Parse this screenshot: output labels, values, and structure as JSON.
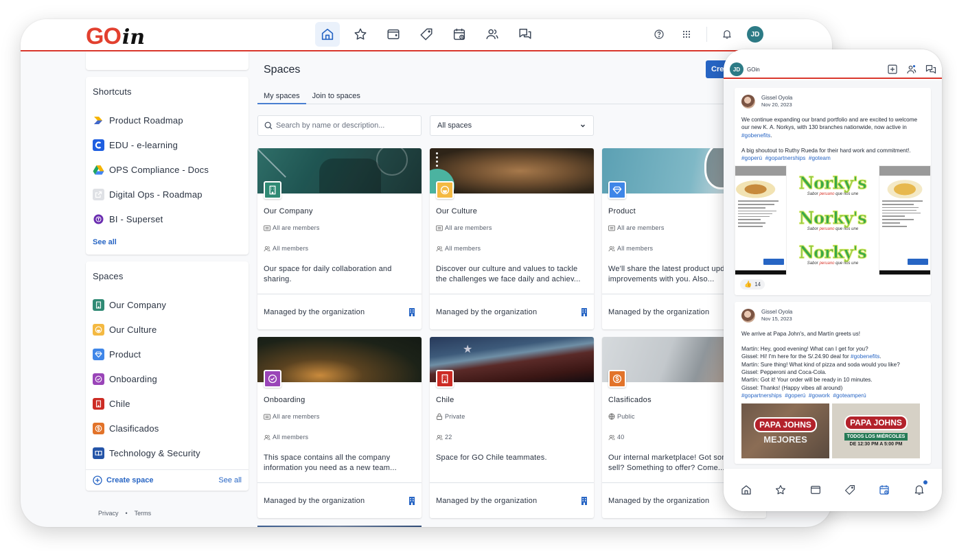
{
  "app": {
    "brand_go": "GO",
    "brand_in": "in",
    "user_initials": "JD"
  },
  "topnav": {
    "items": [
      {
        "name": "home",
        "icon": "home-icon",
        "active": true
      },
      {
        "name": "favorites",
        "icon": "star-icon",
        "active": false
      },
      {
        "name": "wallet",
        "icon": "wallet-icon",
        "active": false
      },
      {
        "name": "benefits",
        "icon": "tag-icon",
        "active": false
      },
      {
        "name": "events",
        "icon": "calendar-icon",
        "active": false
      },
      {
        "name": "people",
        "icon": "people-icon",
        "active": false
      },
      {
        "name": "messages",
        "icon": "chat-icon",
        "active": false
      }
    ],
    "right_icons": [
      "help-icon",
      "apps-grid-icon",
      "bell-icon"
    ]
  },
  "sidebar": {
    "shortcuts": {
      "title": "Shortcuts",
      "items": [
        {
          "label": "Product Roadmap",
          "icon": "roadmap-app-icon"
        },
        {
          "label": "EDU - e-learning",
          "icon": "elearning-app-icon"
        },
        {
          "label": "OPS Compliance - Docs",
          "icon": "google-drive-icon"
        },
        {
          "label": "Digital Ops - Roadmap",
          "icon": "external-link-icon"
        },
        {
          "label": "BI - Superset",
          "icon": "superset-app-icon"
        }
      ],
      "see_all": "See all"
    },
    "spaces": {
      "title": "Spaces",
      "items": [
        {
          "label": "Our Company",
          "color": "#2f8a74",
          "icon": "building-icon"
        },
        {
          "label": "Our Culture",
          "color": "#f4b942",
          "icon": "smiley-icon"
        },
        {
          "label": "Product",
          "color": "#3f86e8",
          "icon": "diamond-icon"
        },
        {
          "label": "Onboarding",
          "color": "#9a45b8",
          "icon": "verified-badge-icon"
        },
        {
          "label": "Chile",
          "color": "#cc2b24",
          "icon": "building-icon"
        },
        {
          "label": "Clasificados",
          "color": "#e2732a",
          "icon": "dollar-coin-icon"
        },
        {
          "label": "Technology & Security",
          "color": "#2555a8",
          "icon": "book-icon"
        }
      ],
      "create_label": "Create space",
      "see_all": "See all"
    },
    "legal": {
      "privacy": "Privacy",
      "separator": "•",
      "terms": "Terms"
    }
  },
  "main": {
    "title": "Spaces",
    "create_button": "Cre",
    "tabs": [
      {
        "label": "My spaces",
        "active": true
      },
      {
        "label": "Join to spaces",
        "active": false
      }
    ],
    "search_placeholder": "Search by name or description...",
    "filter_value": "All spaces",
    "cards": [
      {
        "name": "Our Company",
        "color": "#2f8a74",
        "icon": "building-icon",
        "access_icon": "members-card-icon",
        "access": "All are members",
        "members": "All members",
        "description": "Our space for daily collaboration and sharing.",
        "footer": "Managed by the organization",
        "banner": "teal-office"
      },
      {
        "name": "Our Culture",
        "color": "#f4b942",
        "icon": "smiley-icon",
        "access_icon": "members-card-icon",
        "access": "All are members",
        "members": "All members",
        "description": "Discover our culture and values to tackle the challenges we face daily and achiev...",
        "footer": "Managed by the organization",
        "banner": "brown-hands"
      },
      {
        "name": "Product",
        "color": "#3f86e8",
        "icon": "diamond-icon",
        "access_icon": "members-card-icon",
        "access": "All are members",
        "members": "All members",
        "description": "We'll share the latest product updates and improvements with you. Also...",
        "footer": "Managed by the organization",
        "banner": "blue-gears"
      },
      {
        "name": "Onboarding",
        "color": "#9a45b8",
        "icon": "verified-badge-icon",
        "access_icon": "members-card-icon",
        "access": "All are members",
        "members": "All members",
        "description": "This space contains all the company information you need as a new team...",
        "footer": "Managed by the organization",
        "banner": "dark-gold"
      },
      {
        "name": "Chile",
        "color": "#cc2b24",
        "icon": "building-icon",
        "access_icon": "lock-icon",
        "access": "Private",
        "members": "22",
        "description": "Space for GO Chile teammates.",
        "footer": "Managed by the organization",
        "banner": "chile-flag"
      },
      {
        "name": "Clasificados",
        "color": "#e2732a",
        "icon": "dollar-coin-icon",
        "access_icon": "globe-icon",
        "access": "Public",
        "members": "40",
        "description": "Our internal marketplace! Got something to sell? Something to offer? Come...",
        "footer": "Managed by the organization",
        "banner": "laptop"
      }
    ]
  },
  "phone": {
    "user_initials": "JD",
    "brand": "GOin",
    "posts": [
      {
        "author": "Gissel Oyola",
        "date": "Nov 20, 2023",
        "text_1": "We continue expanding our brand portfolio and are excited to welcome our new K. A. Norkys, with 130 branches nationwide, now active in ",
        "tag_1": "#gobenefits",
        "text_2": ".\n\nA big shoutout to Ruthy Rueda for their hard work and commitment!. ",
        "tags": [
          "#goperú",
          "#gopartnerships",
          "#goteam"
        ],
        "image_brand": "Norky's",
        "image_slogan_1": "Sabor ",
        "image_slogan_2": "peruano",
        "image_slogan_3": " que nos une",
        "reaction_count": "14"
      },
      {
        "author": "Gissel Oyola",
        "date": "Nov 15, 2023",
        "lines": [
          "We arrive at Papa John's, and Martín greets us!",
          "",
          "Martín: Hey, good evening! What can I get for you?"
        ],
        "line_gissel_1": "Gissel: Hi! I'm here for the S/.24.90 deal for ",
        "line_gissel_1_tag": "#gobenefits",
        "lines_2": [
          "Martín: Sure thing! What kind of pizza and soda would you like?",
          "Gissel: Pepperoni and Coca-Cola.",
          "Martín: Got it! Your order will be ready in 10 minutes.",
          "Gissel: Thanks! (Happy vibes all around)"
        ],
        "tags": [
          "#gopartnerships",
          "#goperú",
          "#gowork",
          "#goteamperú"
        ],
        "image_1_logo": "PAPA JOHNS",
        "image_1_text": "MEJORES",
        "image_2_logo": "PAPA JOHNS",
        "image_2_banner": "TODOS LOS MIÉRCOLES",
        "image_2_hours": "DE 12:30 PM A 5:00 PM"
      }
    ],
    "bottom_nav": [
      "home-icon",
      "star-icon",
      "wallet-icon",
      "tag-icon",
      "calendar-icon",
      "bell-icon"
    ],
    "bottom_nav_active": "calendar-icon",
    "notification_dot": true
  }
}
